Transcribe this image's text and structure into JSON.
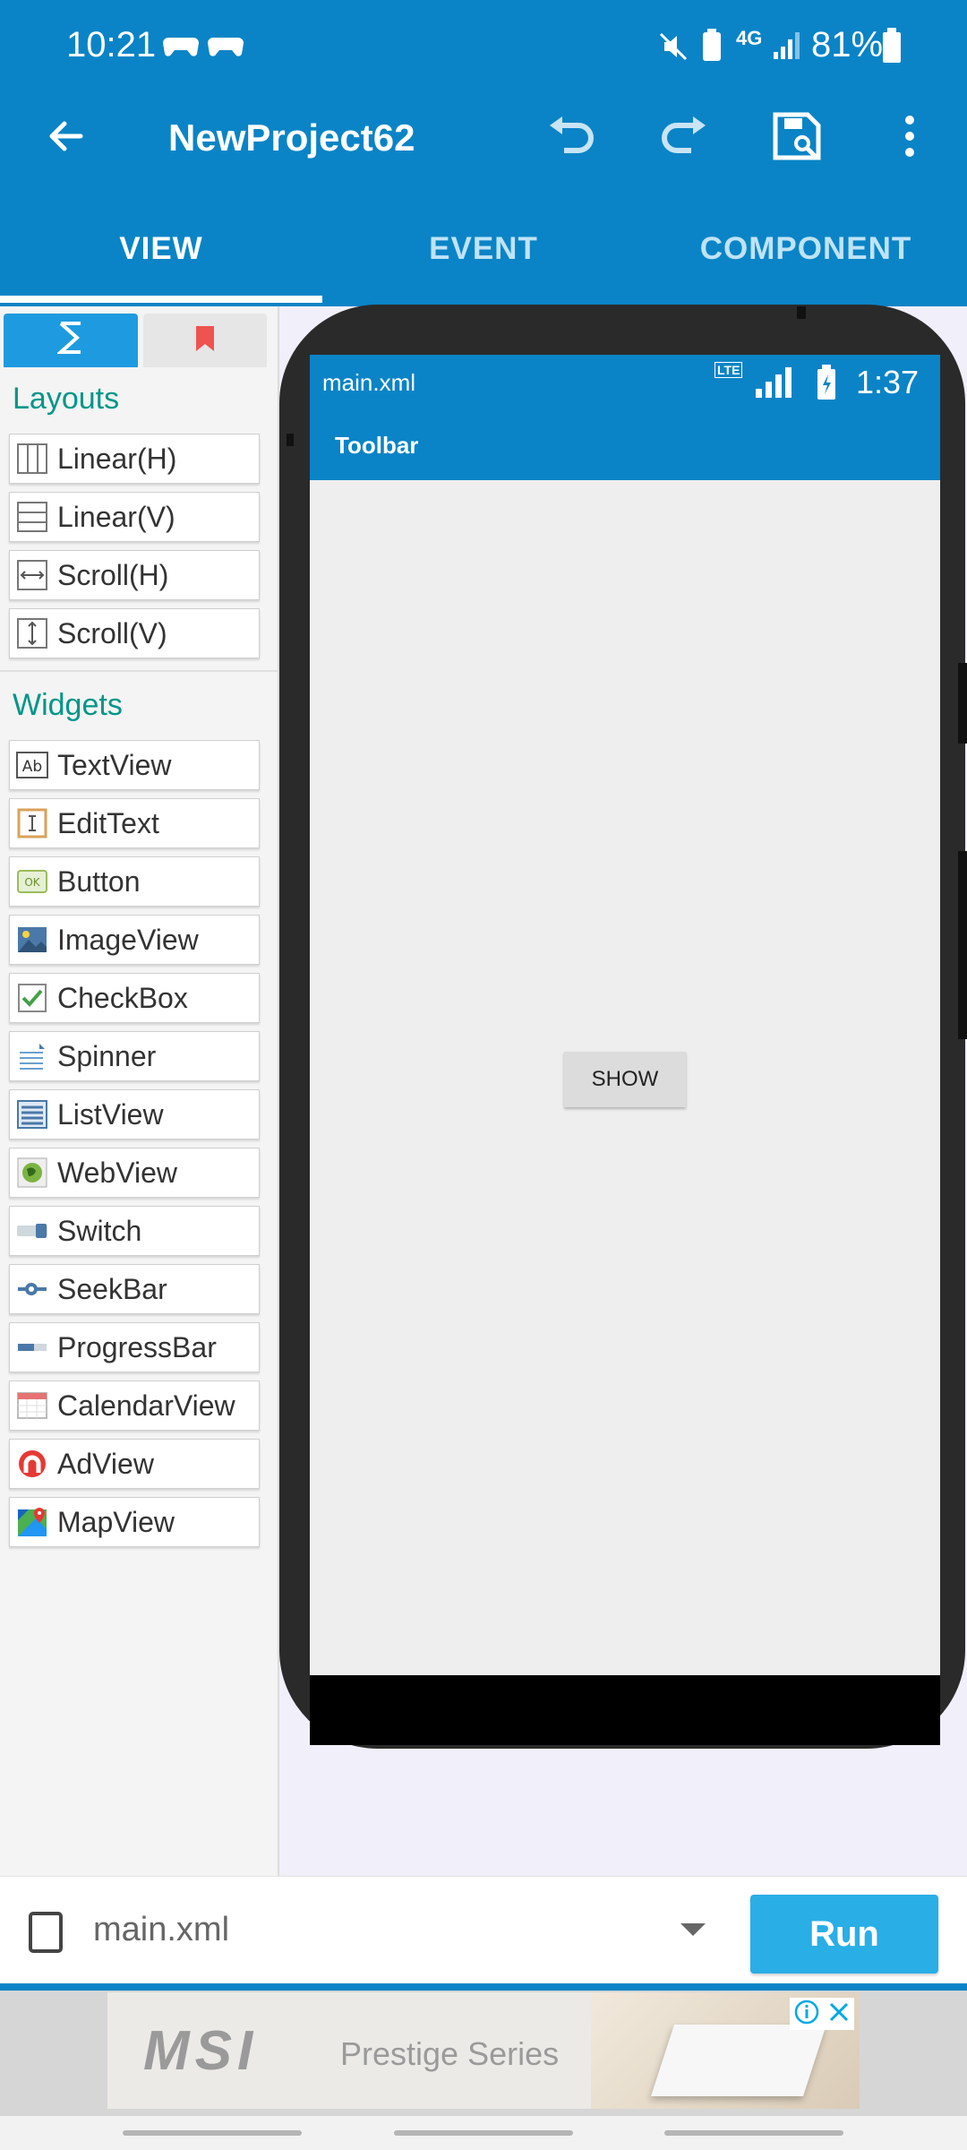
{
  "status_bar": {
    "time": "10:21",
    "battery": "81%",
    "network": "4G"
  },
  "app_bar": {
    "title": "NewProject62",
    "icons": [
      "back-arrow-icon",
      "undo-icon",
      "redo-icon",
      "save-icon",
      "more-vert-icon"
    ]
  },
  "tabs": [
    {
      "label": "VIEW",
      "active": true
    },
    {
      "label": "EVENT",
      "active": false
    },
    {
      "label": "COMPONENT",
      "active": false
    }
  ],
  "palette": {
    "layouts_title": "Layouts",
    "layouts": [
      {
        "label": "Linear(H)",
        "icon": "linear-h-icon"
      },
      {
        "label": "Linear(V)",
        "icon": "linear-v-icon"
      },
      {
        "label": "Scroll(H)",
        "icon": "scroll-h-icon"
      },
      {
        "label": "Scroll(V)",
        "icon": "scroll-v-icon"
      }
    ],
    "widgets_title": "Widgets",
    "widgets": [
      {
        "label": "TextView",
        "icon": "textview-icon"
      },
      {
        "label": "EditText",
        "icon": "edittext-icon"
      },
      {
        "label": "Button",
        "icon": "button-icon"
      },
      {
        "label": "ImageView",
        "icon": "imageview-icon"
      },
      {
        "label": "CheckBox",
        "icon": "checkbox-icon"
      },
      {
        "label": "Spinner",
        "icon": "spinner-icon"
      },
      {
        "label": "ListView",
        "icon": "listview-icon"
      },
      {
        "label": "WebView",
        "icon": "webview-icon"
      },
      {
        "label": "Switch",
        "icon": "switch-icon"
      },
      {
        "label": "SeekBar",
        "icon": "seekbar-icon"
      },
      {
        "label": "ProgressBar",
        "icon": "progressbar-icon"
      },
      {
        "label": "CalendarView",
        "icon": "calendarview-icon"
      },
      {
        "label": "AdView",
        "icon": "adview-icon"
      },
      {
        "label": "MapView",
        "icon": "mapview-icon"
      }
    ]
  },
  "preview": {
    "file": "main.xml",
    "network": "LTE",
    "time": "1:37",
    "toolbar_title": "Toolbar",
    "button_label": "SHOW"
  },
  "bottom_bar": {
    "file_name": "main.xml",
    "run_label": "Run"
  },
  "ad": {
    "brand": "MSI",
    "tagline": "Prestige Series"
  },
  "colors": {
    "primary": "#0a84c6",
    "accent": "#29aee6",
    "section_title": "#009688"
  }
}
